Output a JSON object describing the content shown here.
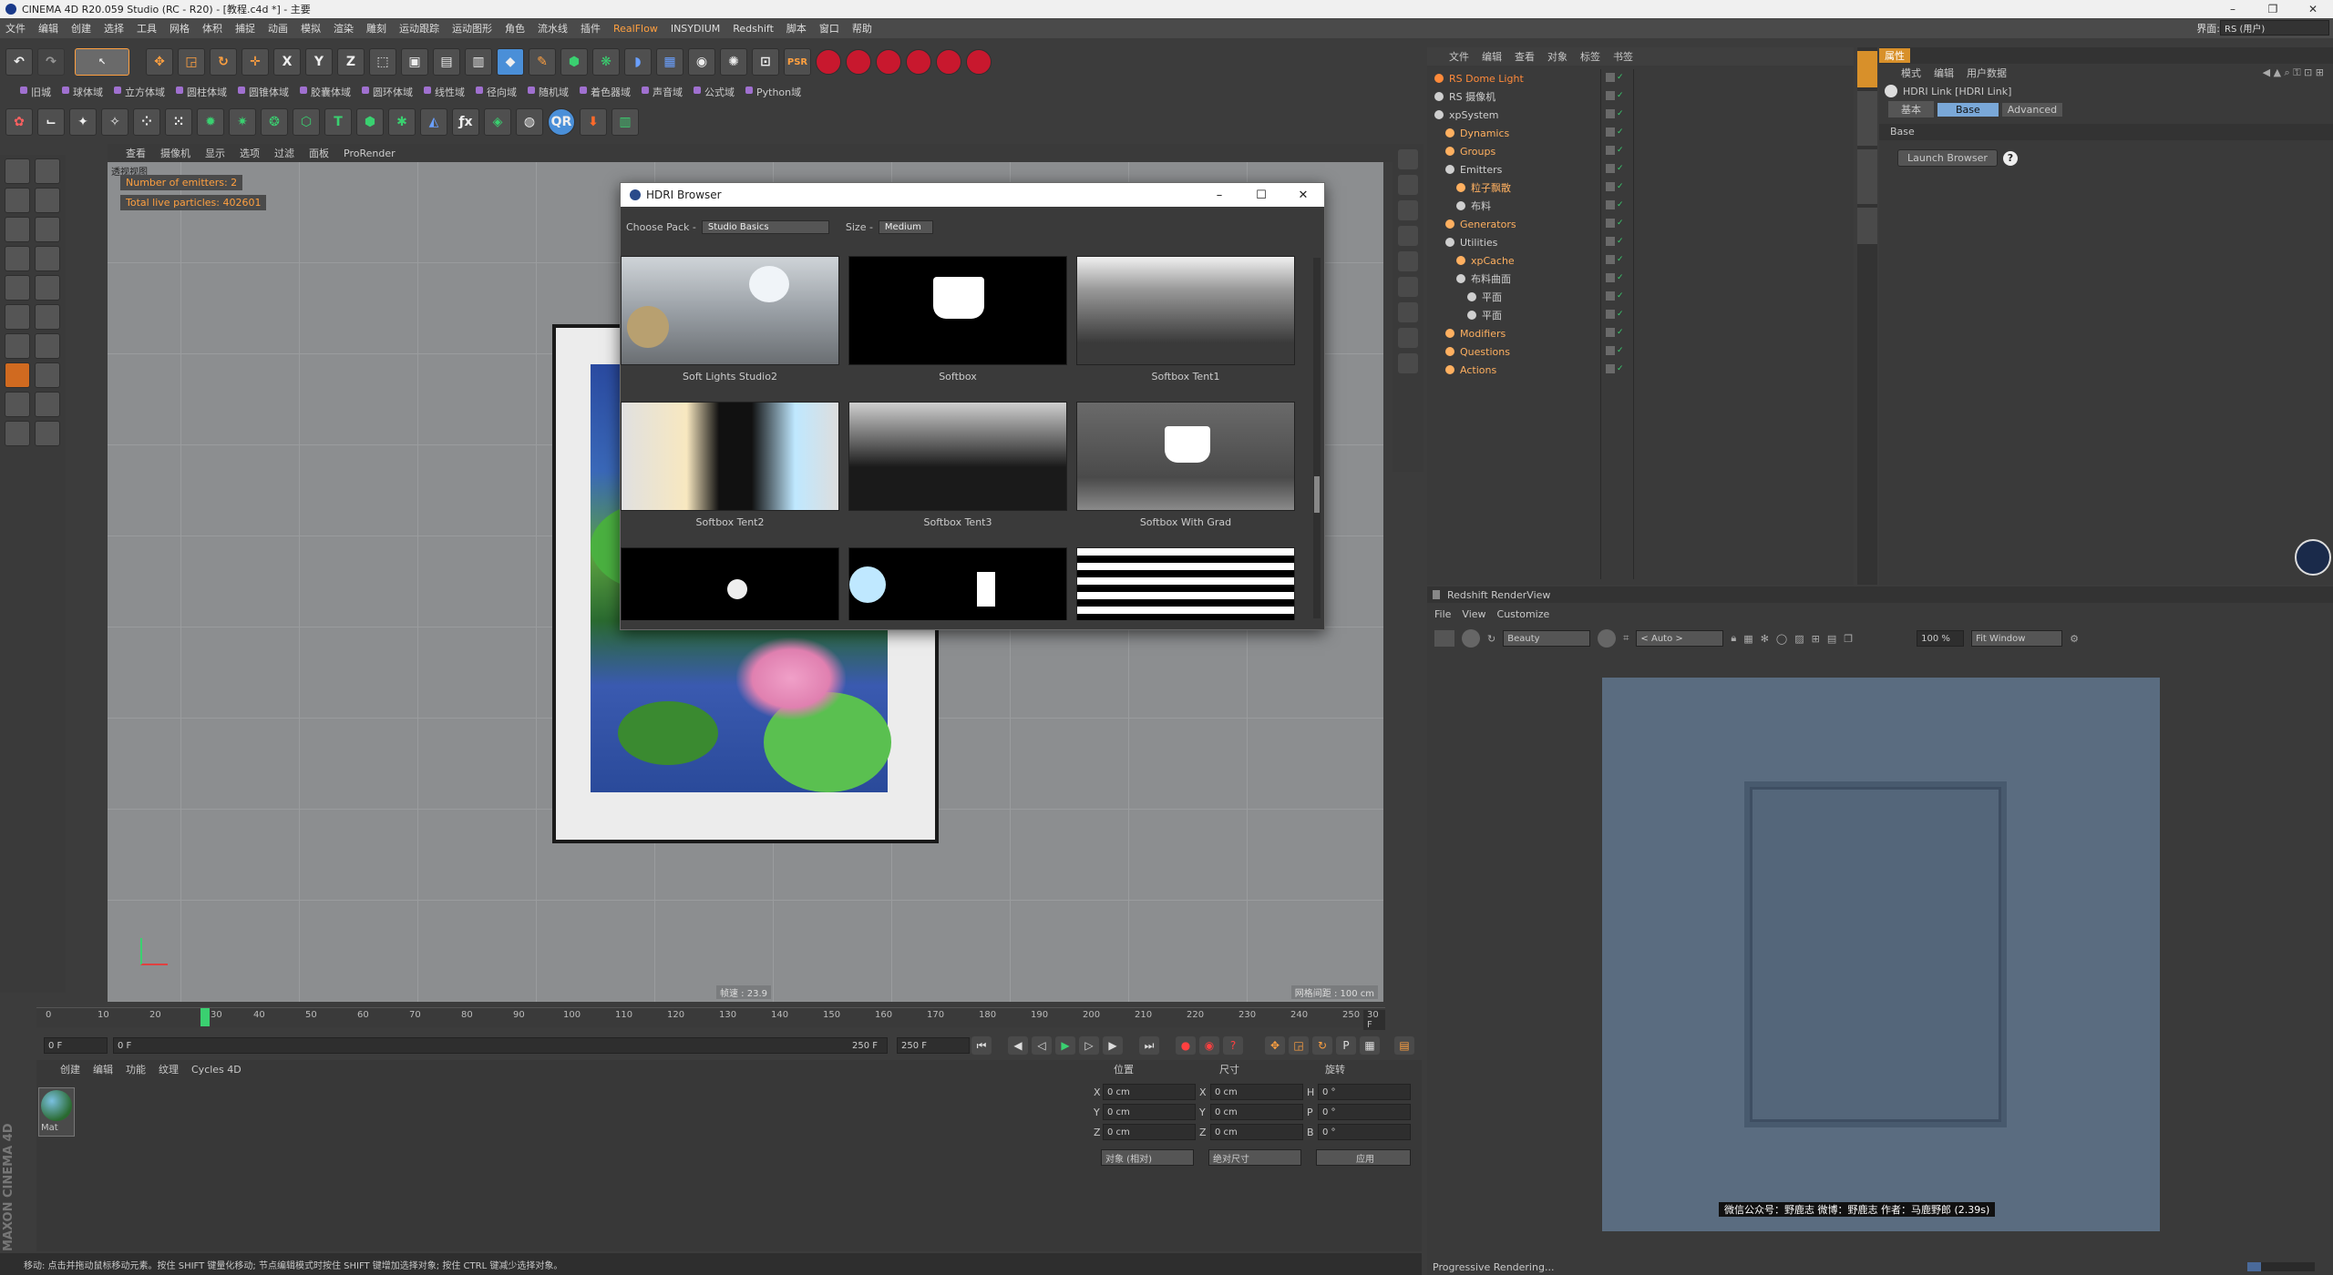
{
  "window": {
    "title": "CINEMA 4D R20.059 Studio (RC - R20) - [教程.c4d *] - 主要"
  },
  "menubar": {
    "items": [
      "文件",
      "编辑",
      "创建",
      "选择",
      "工具",
      "网格",
      "体积",
      "捕捉",
      "动画",
      "模拟",
      "渲染",
      "雕刻",
      "运动跟踪",
      "运动图形",
      "角色",
      "流水线",
      "插件",
      "RealFlow",
      "INSYDIUM",
      "Redshift",
      "脚本",
      "窗口",
      "帮助"
    ],
    "interface_label": "界面:",
    "interface_value": "RS (用户)"
  },
  "plugin_row": [
    "旧城",
    "球体域",
    "立方体域",
    "圆柱体域",
    "圆锥体域",
    "胶囊体域",
    "圆环体域",
    "线性域",
    "径向域",
    "随机域",
    "着色器域",
    "声音域",
    "公式域",
    "Python域"
  ],
  "viewport": {
    "menu": [
      "查看",
      "摄像机",
      "显示",
      "选项",
      "过滤",
      "面板",
      "ProRender"
    ],
    "label": "透视视图",
    "badge_emitters": "Number of emitters: 2",
    "badge_particles": "Total live particles: 402601",
    "fps": "帧速 : 23.9",
    "grid_spacing": "网格间距 : 100 cm"
  },
  "hdri_browser": {
    "title": "HDRI Browser",
    "choose_pack_label": "Choose Pack -",
    "pack_value": "Studio Basics",
    "size_label": "Size -",
    "size_value": "Medium",
    "thumbs": [
      {
        "name": "Soft Lights Studio2"
      },
      {
        "name": "Softbox"
      },
      {
        "name": "Softbox Tent1"
      },
      {
        "name": "Softbox Tent2"
      },
      {
        "name": "Softbox Tent3"
      },
      {
        "name": "Softbox With Grad"
      }
    ]
  },
  "timeline": {
    "ticks": [
      "0",
      "10",
      "20",
      "30",
      "40",
      "50",
      "60",
      "70",
      "80",
      "90",
      "100",
      "110",
      "120",
      "130",
      "140",
      "150",
      "160",
      "170",
      "180",
      "190",
      "200",
      "210",
      "220",
      "230",
      "240",
      "250"
    ],
    "current_frame_marker": "30",
    "end_label": "30 F",
    "start_field": "0 F",
    "range_start": "0 F",
    "range_end": "250 F",
    "end_field": "250 F"
  },
  "material_panel": {
    "tabs": [
      "创建",
      "编辑",
      "功能",
      "纹理",
      "Cycles 4D"
    ],
    "material_name": "Mat"
  },
  "coordinates": {
    "headers": [
      "位置",
      "尺寸",
      "旋转"
    ],
    "rows": [
      {
        "axis": "X",
        "pos": "0 cm",
        "size_axis": "X",
        "size": "0 cm",
        "rot_axis": "H",
        "rot": "0 °"
      },
      {
        "axis": "Y",
        "pos": "0 cm",
        "size_axis": "Y",
        "size": "0 cm",
        "rot_axis": "P",
        "rot": "0 °"
      },
      {
        "axis": "Z",
        "pos": "0 cm",
        "size_axis": "Z",
        "size": "0 cm",
        "rot_axis": "B",
        "rot": "0 °"
      }
    ],
    "mode1": "对象 (相对)",
    "mode2": "绝对尺寸",
    "apply": "应用"
  },
  "status_bar": "移动: 点击并拖动鼠标移动元素。按住 SHIFT 键量化移动; 节点编辑模式时按住 SHIFT 键增加选择对象; 按住 CTRL 键减少选择对象。",
  "object_manager": {
    "menu": [
      "文件",
      "编辑",
      "查看",
      "对象",
      "标签",
      "书签"
    ],
    "objects": [
      {
        "name": "RS Dome Light",
        "indent": 0,
        "color": "#ff8a3a"
      },
      {
        "name": "RS 摄像机",
        "indent": 0,
        "color": "#cfcfcf"
      },
      {
        "name": "xpSystem",
        "indent": 0,
        "color": "#cfcfcf"
      },
      {
        "name": "Dynamics",
        "indent": 1,
        "color": "#ffb060"
      },
      {
        "name": "Groups",
        "indent": 1,
        "color": "#ffb060"
      },
      {
        "name": "Emitters",
        "indent": 1,
        "color": "#cfcfcf"
      },
      {
        "name": "粒子飘散",
        "indent": 2,
        "color": "#ffb060"
      },
      {
        "name": "布料",
        "indent": 2,
        "color": "#cfcfcf"
      },
      {
        "name": "Generators",
        "indent": 1,
        "color": "#ffb060"
      },
      {
        "name": "Utilities",
        "indent": 1,
        "color": "#cfcfcf"
      },
      {
        "name": "xpCache",
        "indent": 2,
        "color": "#ffb060"
      },
      {
        "name": "布料曲面",
        "indent": 2,
        "color": "#cfcfcf"
      },
      {
        "name": "平面",
        "indent": 3,
        "color": "#cfcfcf"
      },
      {
        "name": "平面",
        "indent": 3,
        "color": "#cfcfcf"
      },
      {
        "name": "Modifiers",
        "indent": 1,
        "color": "#ffb060"
      },
      {
        "name": "Questions",
        "indent": 1,
        "color": "#ffb060"
      },
      {
        "name": "Actions",
        "indent": 1,
        "color": "#ffb060"
      }
    ]
  },
  "attributes": {
    "tab": "属性",
    "menu": [
      "模式",
      "编辑",
      "用户数据"
    ],
    "object_title": "HDRI Link [HDRI Link]",
    "tabs": [
      "基本",
      "Base",
      "Advanced"
    ],
    "section": "Base",
    "launch_button": "Launch Browser"
  },
  "render_view": {
    "title": "Redshift RenderView",
    "menu": [
      "File",
      "View",
      "Customize"
    ],
    "aov": "Beauty",
    "auto": "< Auto >",
    "zoom": "100 %",
    "fit": "Fit Window",
    "watermark": "微信公众号：野鹿志  微博：野鹿志  作者：马鹿野郎 (2.39s)",
    "status": "Progressive Rendering..."
  },
  "branding": "MAXON CINEMA 4D",
  "colors": {
    "accent": "#ffa040",
    "record": "#c8182e",
    "playhead": "#3ad070"
  }
}
